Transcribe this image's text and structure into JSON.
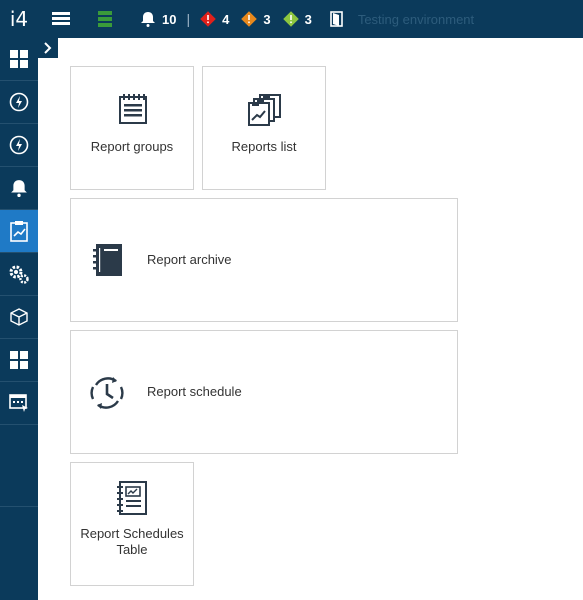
{
  "app": {
    "logo": "i4"
  },
  "topbar": {
    "bell_count": "10",
    "separator": "|",
    "red_count": "4",
    "orange_count": "3",
    "green_count": "3",
    "environment": "Testing environment"
  },
  "tiles": {
    "report_groups": "Report groups",
    "reports_list": "Reports list",
    "report_archive": "Report archive",
    "report_schedule": "Report schedule",
    "report_schedules_table_line1": "Report Schedules",
    "report_schedules_table_line2": "Table"
  },
  "colors": {
    "nav_bg": "#0b3a5b",
    "active_bg": "#1f7ac6",
    "alert_red": "#e0201b",
    "alert_orange": "#e8881c",
    "alert_green": "#8dc63f"
  }
}
